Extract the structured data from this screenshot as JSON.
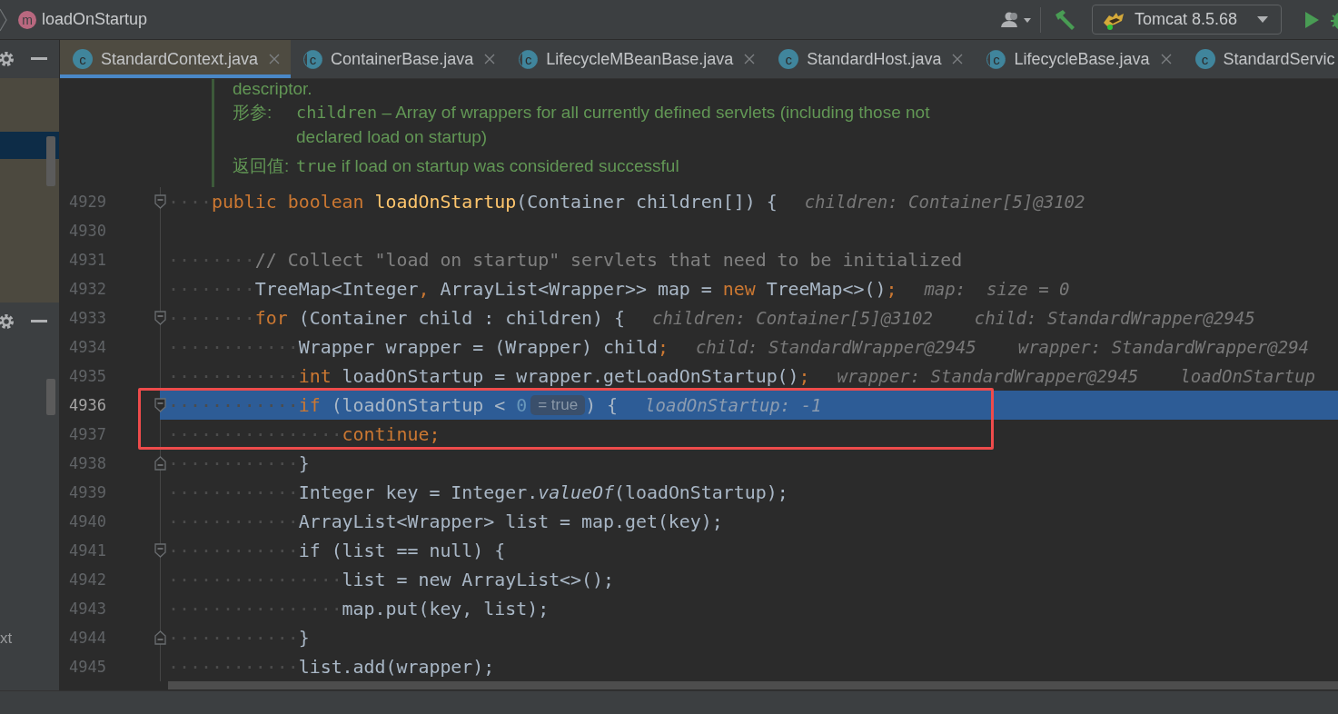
{
  "breadcrumb": {
    "icon_letter": "m",
    "label": "loadOnStartup"
  },
  "run_config": {
    "label": "Tomcat 8.5.68"
  },
  "tabs": [
    {
      "label": "StandardContext.java",
      "icon_letter": "c",
      "kind": "class",
      "selected": true
    },
    {
      "label": "ContainerBase.java",
      "icon_letter": "c",
      "kind": "abstract",
      "selected": false
    },
    {
      "label": "LifecycleMBeanBase.java",
      "icon_letter": "c",
      "kind": "abstract",
      "selected": false
    },
    {
      "label": "StandardHost.java",
      "icon_letter": "c",
      "kind": "class",
      "selected": false
    },
    {
      "label": "LifecycleBase.java",
      "icon_letter": "c",
      "kind": "abstract",
      "selected": false
    },
    {
      "label": "StandardServic",
      "icon_letter": "c",
      "kind": "class",
      "selected": false
    }
  ],
  "left_panel": {
    "fragment": "xt"
  },
  "doc": {
    "cut_line": "descriptor.",
    "param": {
      "label": "形参:",
      "name": "children",
      "text": "– Array of wrappers for all currently defined servlets (including those not declared load on startup)"
    },
    "returns": {
      "label": "返回值:",
      "value": "true",
      "text": "if load on startup was considered successful"
    }
  },
  "lines": [
    {
      "number": "4929",
      "selected": false,
      "fold_start": true,
      "tokens": [
        {
          "kind": "ws",
          "text": "····"
        },
        {
          "kind": "kw",
          "text": "public boolean "
        },
        {
          "kind": "fn",
          "text": "loadOnStartup"
        },
        {
          "kind": "plain",
          "text": "(Container children[]) {"
        },
        {
          "kind": "hint",
          "text": "children: Container[5]@3102"
        }
      ]
    },
    {
      "number": "4930",
      "selected": false
    },
    {
      "number": "4931",
      "selected": false,
      "tokens": [
        {
          "kind": "ws",
          "text": "········"
        },
        {
          "kind": "comment",
          "text": "// Collect \"load on startup\" servlets that need to be initialized"
        }
      ]
    },
    {
      "number": "4932",
      "selected": false,
      "tokens": [
        {
          "kind": "ws",
          "text": "········"
        },
        {
          "kind": "plain",
          "text": "TreeMap<Integer"
        },
        {
          "kind": "kw",
          "text": ", "
        },
        {
          "kind": "plain",
          "text": "ArrayList<Wrapper>> map = "
        },
        {
          "kind": "kw",
          "text": "new "
        },
        {
          "kind": "plain",
          "text": "TreeMap<>()"
        },
        {
          "kind": "kw",
          "text": ";"
        },
        {
          "kind": "hint",
          "text": "map:  size = 0"
        }
      ]
    },
    {
      "number": "4933",
      "selected": false,
      "fold_start": true,
      "tokens": [
        {
          "kind": "ws",
          "text": "········"
        },
        {
          "kind": "kw",
          "text": "for "
        },
        {
          "kind": "plain",
          "text": "(Container child : children) {"
        },
        {
          "kind": "hint",
          "text": "children: Container[5]@3102"
        },
        {
          "kind": "hint",
          "text": "child: StandardWrapper@2945"
        }
      ]
    },
    {
      "number": "4934",
      "selected": false,
      "tokens": [
        {
          "kind": "ws",
          "text": "············"
        },
        {
          "kind": "plain",
          "text": "Wrapper wrapper = (Wrapper) child"
        },
        {
          "kind": "kw",
          "text": ";"
        },
        {
          "kind": "hint",
          "text": "child: StandardWrapper@2945"
        },
        {
          "kind": "hint",
          "text": "wrapper: StandardWrapper@294"
        }
      ]
    },
    {
      "number": "4935",
      "selected": false,
      "tokens": [
        {
          "kind": "ws",
          "text": "············"
        },
        {
          "kind": "kw",
          "text": "int "
        },
        {
          "kind": "plain",
          "text": "loadOnStartup = wrapper.getLoadOnStartup()"
        },
        {
          "kind": "kw",
          "text": ";"
        },
        {
          "kind": "hint",
          "text": "wrapper: StandardWrapper@2945"
        },
        {
          "kind": "hint",
          "text": "loadOnStartup"
        }
      ]
    },
    {
      "number": "4936",
      "selected": true,
      "fold_start": true,
      "tokens": [
        {
          "kind": "ws",
          "text": "············"
        },
        {
          "kind": "kw",
          "text": "if "
        },
        {
          "kind": "plain",
          "text": "(loadOnStartup < "
        },
        {
          "kind": "num",
          "text": "0"
        },
        {
          "kind": "inlay",
          "text": "= true"
        },
        {
          "kind": "plain",
          "text": ") {"
        },
        {
          "kind": "hint",
          "text": "loadOnStartup: -1"
        }
      ]
    },
    {
      "number": "4937",
      "selected": false,
      "tokens": [
        {
          "kind": "ws",
          "text": "················"
        },
        {
          "kind": "kw",
          "text": "continue;"
        }
      ]
    },
    {
      "number": "4938",
      "selected": false,
      "fold_end": true,
      "tokens": [
        {
          "kind": "ws",
          "text": "············"
        },
        {
          "kind": "plain",
          "text": "}"
        }
      ]
    },
    {
      "number": "4939",
      "selected": false,
      "tokens": [
        {
          "kind": "ws",
          "text": "············"
        },
        {
          "kind": "plain",
          "text": "Integer key = Integer."
        },
        {
          "kind": "italic",
          "text": "valueOf"
        },
        {
          "kind": "plain",
          "text": "(loadOnStartup);"
        }
      ]
    },
    {
      "number": "4940",
      "selected": false,
      "tokens": [
        {
          "kind": "ws",
          "text": "············"
        },
        {
          "kind": "plain",
          "text": "ArrayList<Wrapper> list = map.get(key);"
        }
      ]
    },
    {
      "number": "4941",
      "selected": false,
      "fold_start": true,
      "tokens": [
        {
          "kind": "ws",
          "text": "············"
        },
        {
          "kind": "plain",
          "text": "if (list == null) {"
        }
      ]
    },
    {
      "number": "4942",
      "selected": false,
      "tokens": [
        {
          "kind": "ws",
          "text": "················"
        },
        {
          "kind": "plain",
          "text": "list = new ArrayList<>();"
        }
      ]
    },
    {
      "number": "4943",
      "selected": false,
      "tokens": [
        {
          "kind": "ws",
          "text": "················"
        },
        {
          "kind": "plain",
          "text": "map.put(key, list);"
        }
      ]
    },
    {
      "number": "4944",
      "selected": false,
      "fold_end": true,
      "tokens": [
        {
          "kind": "ws",
          "text": "············"
        },
        {
          "kind": "plain",
          "text": "}"
        }
      ]
    },
    {
      "number": "4945",
      "selected": false,
      "tokens": [
        {
          "kind": "ws",
          "text": "············"
        },
        {
          "kind": "plain",
          "text": "list.add(wrapper);"
        }
      ]
    }
  ]
}
